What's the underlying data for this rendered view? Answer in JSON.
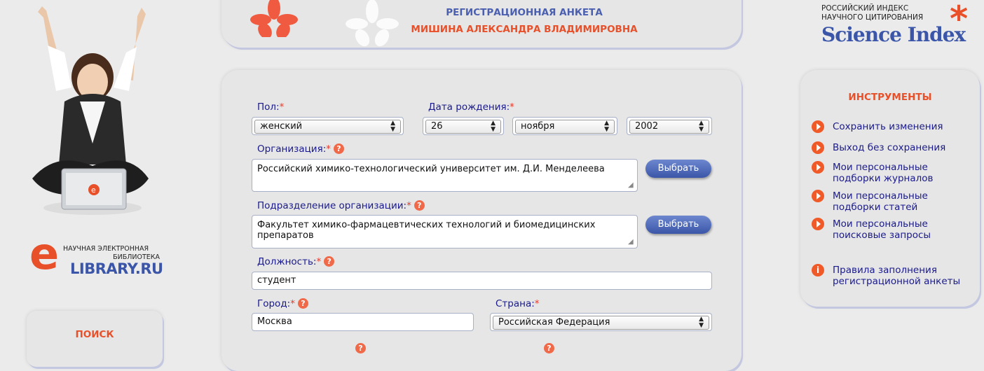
{
  "header": {
    "title": "РЕГИСТРАЦИОННАЯ АНКЕТА",
    "name": "МИШИНА АЛЕКСАНДРА ВЛАДИМИРОВНА"
  },
  "logo_right": {
    "line1": "РОССИЙСКИЙ ИНДЕКС",
    "line2": "НАУЧНОГО ЦИТИРОВАНИЯ",
    "brand": "Science Index",
    "asterisk": "*"
  },
  "logo_left": {
    "line1": "НАУЧНАЯ ЭЛЕКТРОННАЯ",
    "line2": "БИБЛИОТЕКА",
    "brand": "LIBRARY.RU",
    "letter": "e"
  },
  "left_panel": {
    "search_title": "ПОИСК"
  },
  "form": {
    "gender": {
      "label": "Пол:",
      "value": "женский"
    },
    "birth": {
      "label": "Дата рождения:",
      "day": "26",
      "month": "ноября",
      "year": "2002"
    },
    "org": {
      "label": "Организация:",
      "value": "Российский химико-технологический университет им. Д.И. Менделеева",
      "button": "Выбрать"
    },
    "dept": {
      "label": "Подразделение организации:",
      "value": "Факультет химико-фармацевтических технологий и биомедицинских препаратов",
      "button": "Выбрать"
    },
    "position": {
      "label": "Должность:",
      "value": "студент"
    },
    "city": {
      "label": "Город:",
      "value": "Москва"
    },
    "country": {
      "label": "Страна:",
      "value": "Российская Федерация"
    },
    "required_mark": "*",
    "help_mark": "?"
  },
  "tools": {
    "title": "ИНСТРУМЕНТЫ",
    "items": [
      "Сохранить изменения",
      "Выход без сохранения",
      "Мои персональные подборки журналов",
      "Мои персональные подборки статей",
      "Мои персональные поисковые запросы"
    ],
    "info_item": "Правила заполнения регистрационной анкеты"
  },
  "colors": {
    "accent_red": "#e8502a",
    "label_blue": "#1a1a8c",
    "header_blue": "#4a5fb0",
    "button_blue": "#4a64b8",
    "panel_bg": "#e6e6e6"
  }
}
